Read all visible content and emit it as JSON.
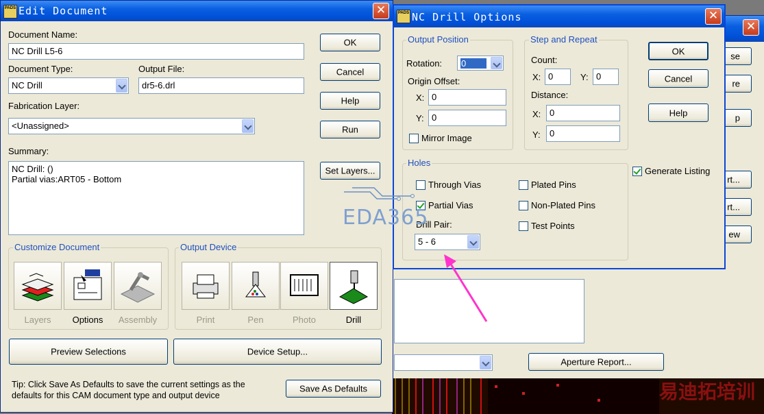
{
  "background_window": {
    "button_partials": [
      "se",
      "re",
      "p",
      "rt...",
      "rt...",
      "ew"
    ],
    "aperture_button": "Aperture Report...",
    "watermark": "易迪拓培训"
  },
  "edit_document": {
    "title": "Edit Document",
    "app_icon_text": "PADS",
    "document_name_label": "Document Name:",
    "document_name_value": "NC Drill L5-6",
    "document_type_label": "Document Type:",
    "document_type_value": "NC Drill",
    "output_file_label": "Output File:",
    "output_file_value": "dr5-6.drl",
    "fabrication_layer_label": "Fabrication Layer:",
    "fabrication_layer_value": "<Unassigned>",
    "summary_label": "Summary:",
    "summary_lines": [
      "NC Drill: ()",
      "Partial vias:ART05 - Bottom"
    ],
    "buttons": {
      "ok": "OK",
      "cancel": "Cancel",
      "help": "Help",
      "run": "Run",
      "set_layers": "Set Layers...",
      "preview": "Preview Selections",
      "device_setup": "Device Setup...",
      "save_defaults": "Save As Defaults"
    },
    "customize_document": {
      "title": "Customize Document",
      "items": [
        "Layers",
        "Options",
        "Assembly"
      ]
    },
    "output_device": {
      "title": "Output Device",
      "items": [
        "Print",
        "Pen",
        "Photo",
        "Drill"
      ]
    },
    "tip": "Tip:  Click Save As Defaults to save the current settings as the defaults for this CAM document type and output device"
  },
  "nc_drill_options": {
    "title": "NC Drill Options",
    "app_icon_text": "PADS",
    "output_position": {
      "title": "Output Position",
      "rotation_label": "Rotation:",
      "rotation_value": "0",
      "origin_offset_label": "Origin Offset:",
      "x_label": "X:",
      "x_value": "0",
      "y_label": "Y:",
      "y_value": "0",
      "mirror_label": "Mirror Image",
      "mirror_checked": false
    },
    "step_repeat": {
      "title": "Step and Repeat",
      "count_label": "Count:",
      "count_x_label": "X:",
      "count_x_value": "0",
      "count_y_label": "Y:",
      "count_y_value": "0",
      "distance_label": "Distance:",
      "dist_x_label": "X:",
      "dist_x_value": "0",
      "dist_y_label": "Y:",
      "dist_y_value": "0"
    },
    "buttons": {
      "ok": "OK",
      "cancel": "Cancel",
      "help": "Help"
    },
    "generate_listing_label": "Generate Listing",
    "generate_listing_checked": true,
    "holes": {
      "title": "Holes",
      "through_vias": "Through Vias",
      "partial_vias": "Partial Vias",
      "plated_pins": "Plated Pins",
      "non_plated_pins": "Non-Plated Pins",
      "test_points": "Test Points",
      "drill_pair_label": "Drill Pair:",
      "drill_pair_value": "5 - 6"
    }
  },
  "watermark_text": "EDA365",
  "colors": {
    "title_bar": "#0a5fe0",
    "group_title": "#1f4fc0",
    "dialog_bg": "#ece9d8",
    "arrow": "#ff33cc"
  }
}
